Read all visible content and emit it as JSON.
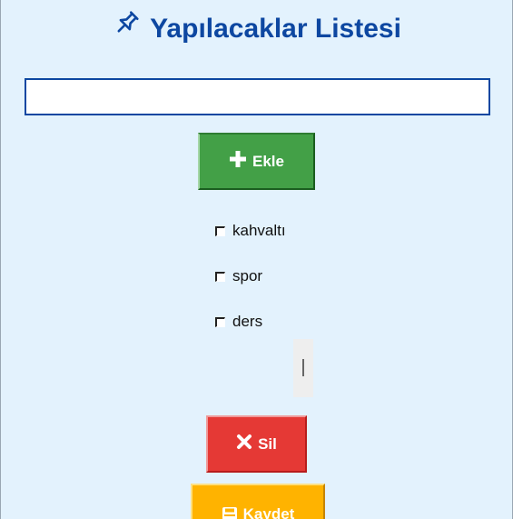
{
  "app": {
    "title": "Yapılacaklar Listesi"
  },
  "input": {
    "value": "",
    "placeholder": ""
  },
  "buttons": {
    "add_label": "Ekle",
    "delete_label": "Sil",
    "save_label": "Kaydet"
  },
  "tasks": [
    {
      "label": "kahvaltı",
      "checked": false
    },
    {
      "label": "spor",
      "checked": false
    },
    {
      "label": "ders",
      "checked": false
    }
  ],
  "icons": {
    "title": "pushpin-icon",
    "add": "plus-icon",
    "delete": "x-icon",
    "save": "save-icon"
  },
  "colors": {
    "background": "#e3f2fd",
    "title": "#0d47a1",
    "input_border": "#0d47a1",
    "add_button": "#43a047",
    "delete_button": "#e53935",
    "save_button": "#ffb300"
  }
}
